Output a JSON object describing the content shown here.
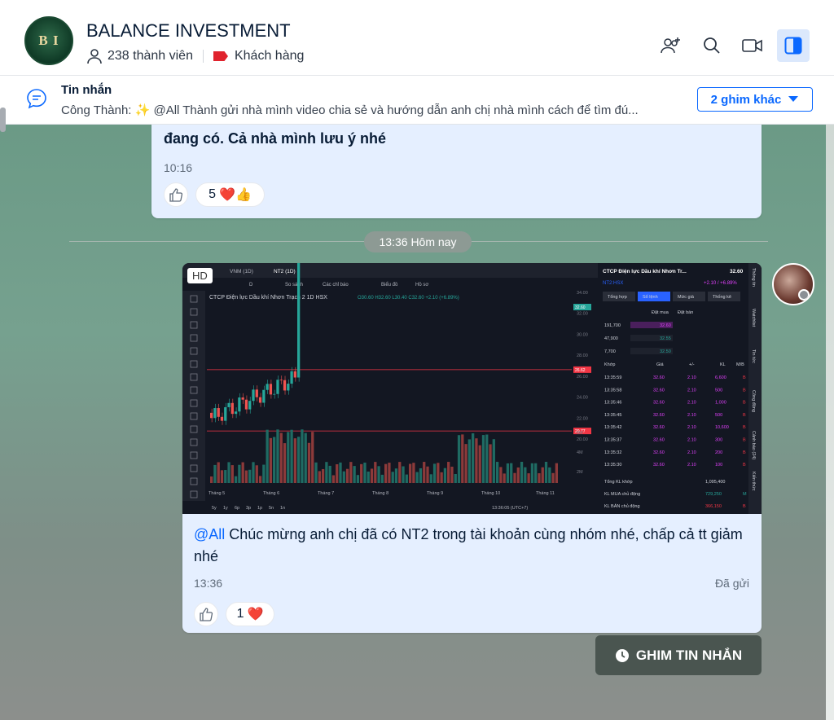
{
  "header": {
    "group_name": "BALANCE INVESTMENT",
    "member_count": "238 thành viên",
    "tag_label": "Khách hàng",
    "logo_text": "B I"
  },
  "pin": {
    "title": "Tin nhắn",
    "text": "Công Thành: ✨ @All Thành gửi nhà mình video chia sẻ và hướng dẫn anh chị nhà mình cách để tìm đú...",
    "more_button": "2 ghim khác"
  },
  "messages": [
    {
      "text": "đang có. Cả nhà mình lưu ý nhé",
      "time": "10:16",
      "reaction_count": "5",
      "reaction_icons": "❤️👍"
    },
    {
      "image_badge": "HD",
      "mention": "@All",
      "text": " Chúc mừng anh chị đã có NT2 trong tài khoản cùng nhóm nhé, chấp cả tt giảm nhé",
      "time": "13:36",
      "status": "Đã gửi",
      "reaction_count": "1",
      "reaction_icons": "❤️"
    }
  ],
  "date_divider": "13:36 Hôm nay",
  "pin_message_button": "GHIM TIN NHẮN",
  "colors": {
    "accent": "#0a68ff",
    "bubble": "#e5efff",
    "chat_bg": "#76a18f"
  },
  "screenshot": {
    "tabs": [
      "VNM (1D)",
      "NT2 (1D)"
    ],
    "toolbar": [
      "D",
      "So sánh",
      "Các chỉ báo",
      "Biểu đồ",
      "Hồ sơ"
    ],
    "chart_title": "CTCP Điện lực Dầu khí Nhơn Trạch 2  1D  HSX",
    "ohlc": "O30.60 H32.60 L30.40 C32.60 +2.10 (+6.89%)",
    "price_axis": [
      "34.00",
      "32.00",
      "30.00",
      "28.00",
      "26.00",
      "24.00",
      "22.00",
      "20.00"
    ],
    "price_tags": [
      "32.60",
      "26.62",
      "20.77"
    ],
    "volume_axis": [
      "6M",
      "4M",
      "2M"
    ],
    "months": [
      "Tháng 5",
      "Tháng 6",
      "Tháng 7",
      "Tháng 8",
      "Tháng 9",
      "Tháng 10",
      "Tháng 11"
    ],
    "ranges": [
      "5y",
      "1y",
      "6p",
      "3p",
      "1p",
      "5n",
      "1n"
    ],
    "clock": "13:36:05 (UTC+7)",
    "company": "CTCP Điện lực Dầu khí Nhơn Tr...",
    "last_price": "32.60",
    "ticker": "NT2:HSX",
    "change": "+2.10 / +6.89%",
    "panel_tabs": [
      "Tổng hợp",
      "Sổ lệnh",
      "Mức giá",
      "Thống kê"
    ],
    "book_headers": [
      "Đặt mua",
      "Đặt bán"
    ],
    "book_rows": [
      [
        "191,700",
        "32.60"
      ],
      [
        "47,900",
        "32.55"
      ],
      [
        "7,700",
        "32.50"
      ]
    ],
    "trade_headers": [
      "Khớp",
      "Giá",
      "+/-",
      "KL",
      "M/B"
    ],
    "trades": [
      [
        "13:35:59",
        "32.60",
        "2.10",
        "6,600",
        "B"
      ],
      [
        "13:35:58",
        "32.60",
        "2.10",
        "500",
        "B"
      ],
      [
        "13:35:46",
        "32.60",
        "2.10",
        "1,000",
        "B"
      ],
      [
        "13:35:45",
        "32.60",
        "2.10",
        "500",
        "B"
      ],
      [
        "13:35:42",
        "32.60",
        "2.10",
        "10,600",
        "B"
      ],
      [
        "13:35:37",
        "32.60",
        "2.10",
        "300",
        "B"
      ],
      [
        "13:35:32",
        "32.60",
        "2.10",
        "200",
        "B"
      ],
      [
        "13:35:30",
        "32.60",
        "2.10",
        "100",
        "B"
      ]
    ],
    "totals": [
      [
        "Tổng KL khớp",
        "1,095,400",
        ""
      ],
      [
        "KL MUA chủ động",
        "729,250",
        "M"
      ],
      [
        "KL BÁN chủ động",
        "366,150",
        "B"
      ]
    ],
    "side_tabs": [
      "Thông tin",
      "Watchlist",
      "Tin tức",
      "Công động",
      "Cảnh báo (24)",
      "Kiến thức"
    ]
  }
}
